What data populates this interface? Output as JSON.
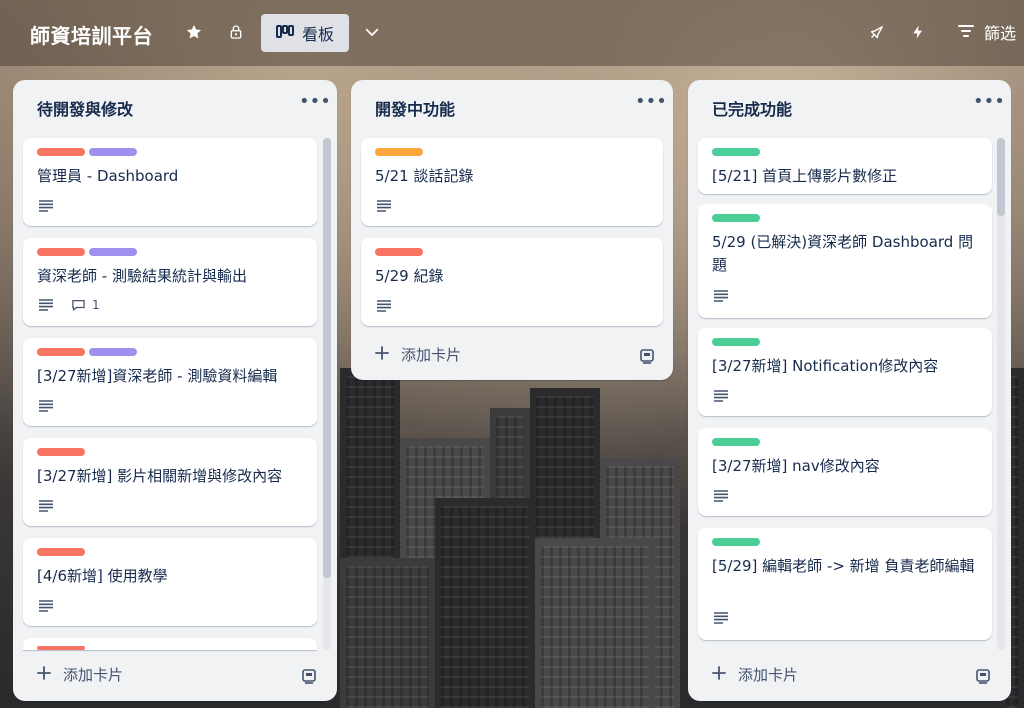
{
  "header": {
    "board_title": "師資培訓平台",
    "view_label": "看板",
    "filter_label": "篩选",
    "icons": [
      "star-icon",
      "lock-icon",
      "board-view-icon",
      "chevron-down-icon",
      "rocket-icon",
      "bolt-icon",
      "filter-icon"
    ]
  },
  "colors": {
    "red": "#f87462",
    "purple": "#9f8fef",
    "orange": "#faa53d",
    "green": "#4bce97"
  },
  "lists": [
    {
      "title": "待開發與修改",
      "add_card": "添加卡片",
      "cards": [
        {
          "labels": [
            "red",
            "purple"
          ],
          "title": "管理員 - Dashboard",
          "has_description": true
        },
        {
          "labels": [
            "red",
            "purple"
          ],
          "title": "資深老師 - 測驗結果統計與輸出",
          "has_description": true,
          "comments": "1"
        },
        {
          "labels": [
            "red",
            "purple"
          ],
          "title": "[3/27新增]資深老師 - 測驗資料編輯",
          "has_description": true
        },
        {
          "labels": [
            "red"
          ],
          "title": "[3/27新增] 影片相關新增與修改內容",
          "has_description": true
        },
        {
          "labels": [
            "red"
          ],
          "title": "[4/6新增] 使用教學",
          "has_description": true
        }
      ]
    },
    {
      "title": "開發中功能",
      "add_card": "添加卡片",
      "cards": [
        {
          "labels": [
            "orange"
          ],
          "title": "5/21 談話記錄",
          "has_description": true
        },
        {
          "labels": [
            "red"
          ],
          "title": "5/29 紀錄",
          "has_description": true
        }
      ]
    },
    {
      "title": "已完成功能",
      "add_card": "添加卡片",
      "cards": [
        {
          "labels": [
            "green"
          ],
          "title": "[5/21] 首頁上傳影片數修正",
          "has_description": false
        },
        {
          "labels": [
            "green"
          ],
          "title": "5/29 (已解決)資深老師 Dashboard 問題",
          "has_description": true
        },
        {
          "labels": [
            "green"
          ],
          "title": "[3/27新增] Notification修改內容",
          "has_description": true
        },
        {
          "labels": [
            "green"
          ],
          "title": "[3/27新增] nav修改內容",
          "has_description": true
        },
        {
          "labels": [
            "green"
          ],
          "title": "[5/29] 編輯老師 -> 新增 負責老師編輯",
          "has_description": true
        }
      ]
    }
  ]
}
